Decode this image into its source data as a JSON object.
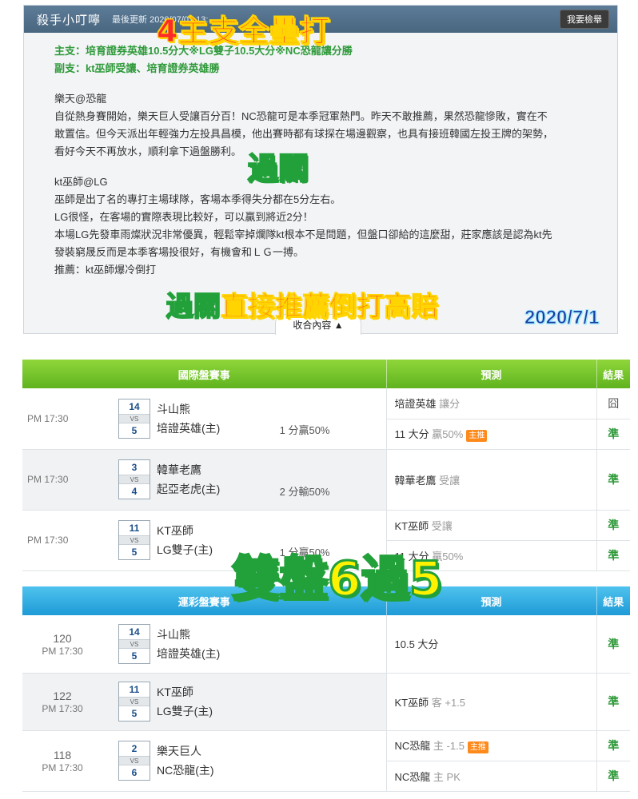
{
  "card": {
    "title": "殺手小叮嚀",
    "updated": "最後更新 2020/07/01 13:",
    "report_button": "我要檢舉",
    "main_pick": "主支：培育證券英雄10.5分大※LG雙子10.5大分※NC恐龍讓分勝",
    "side_pick": "副支：kt巫師受讓、培育證券英雄勝",
    "para1": [
      "樂天@恐龍",
      "自從熱身賽開始，樂天巨人受讓百分百！NC恐龍可是本季冠軍熱門。昨天不敢推薦，果然恐龍慘敗，實在不",
      "敢置信。但今天派出年輕強力左投具昌模，他出賽時都有球探在場邊觀察，也具有接班韓國左投王牌的架勢，",
      "看好今天不再放水，順利拿下過盤勝利。"
    ],
    "para2": [
      "kt巫師@LG",
      "巫師是出了名的專打主場球隊，客場本季得失分都在5分左右。",
      "LG很怪，在客場的實際表現比較好，可以贏到將近2分！",
      "本場LG先發車雨燦狀況非常優異，輕鬆宰掉爛隊kt根本不是問題，但盤口卻給的這麼甜，莊家應該是認為kt先",
      "發裝窮晟反而是本季客場投很好，有機會和ＬＧ一搏。",
      "推薦：kt巫師爆冷倒打"
    ],
    "collapse": "收合內容 ▲"
  },
  "overlays": {
    "top": "4主支全壘打",
    "pass1": "過關",
    "bottom_pass": "過關",
    "bottom_rest": "直接推薦倒打高賠",
    "date": "2020/7/1",
    "big": "雙盤6過5"
  },
  "table1": {
    "headers": [
      "國際盤賽事",
      "預測",
      "結果"
    ],
    "games": [
      {
        "time": "PM 17:30",
        "s1": "14",
        "s2": "5",
        "t1": "斗山熊",
        "t2": "培證英雄(主)",
        "handi": "1 分贏50%",
        "preds": [
          {
            "text": "培證英雄",
            "sub": "讓分",
            "tag": "",
            "result": "囧"
          },
          {
            "text": "11 大分",
            "sub": "贏50%",
            "tag": "主推",
            "result": "準"
          }
        ]
      },
      {
        "time": "PM 17:30",
        "s1": "3",
        "s2": "4",
        "t1": "韓華老鷹",
        "t2": "起亞老虎(主)",
        "handi": "2 分輸50%",
        "preds": [
          {
            "text": "韓華老鷹",
            "sub": "受讓",
            "tag": "",
            "result": "準"
          }
        ]
      },
      {
        "time": "PM 17:30",
        "s1": "11",
        "s2": "5",
        "t1": "KT巫師",
        "t2": "LG雙子(主)",
        "handi": "1 分贏50%",
        "preds": [
          {
            "text": "KT巫師",
            "sub": "受讓",
            "tag": "",
            "result": "準"
          },
          {
            "text": "11 大分",
            "sub": "贏50%",
            "tag": "",
            "result": "準"
          }
        ]
      }
    ]
  },
  "table2": {
    "headers": [
      "運彩盤賽事",
      "預測",
      "結果"
    ],
    "games": [
      {
        "num": "120",
        "time": "PM 17:30",
        "s1": "14",
        "s2": "5",
        "t1": "斗山熊",
        "t2": "培證英雄(主)",
        "preds": [
          {
            "text": "10.5 大分",
            "sub": "",
            "tag": "",
            "result": "準"
          }
        ]
      },
      {
        "num": "122",
        "time": "PM 17:30",
        "s1": "11",
        "s2": "5",
        "t1": "KT巫師",
        "t2": "LG雙子(主)",
        "preds": [
          {
            "text": "KT巫師",
            "sub": "客 +1.5",
            "tag": "",
            "result": "準"
          }
        ]
      },
      {
        "num": "118",
        "time": "PM 17:30",
        "s1": "2",
        "s2": "6",
        "t1": "樂天巨人",
        "t2": "NC恐龍(主)",
        "preds": [
          {
            "text": "NC恐龍",
            "sub": "主 -1.5",
            "tag": "主推",
            "result": "準"
          },
          {
            "text": "NC恐龍",
            "sub": "主 PK",
            "tag": "",
            "result": "準"
          }
        ]
      }
    ]
  },
  "colors": {
    "hit": "#2f9a3a",
    "green_header": "#6cbf22",
    "blue_header": "#1e9ad6",
    "tag": "#ff8a1c"
  }
}
